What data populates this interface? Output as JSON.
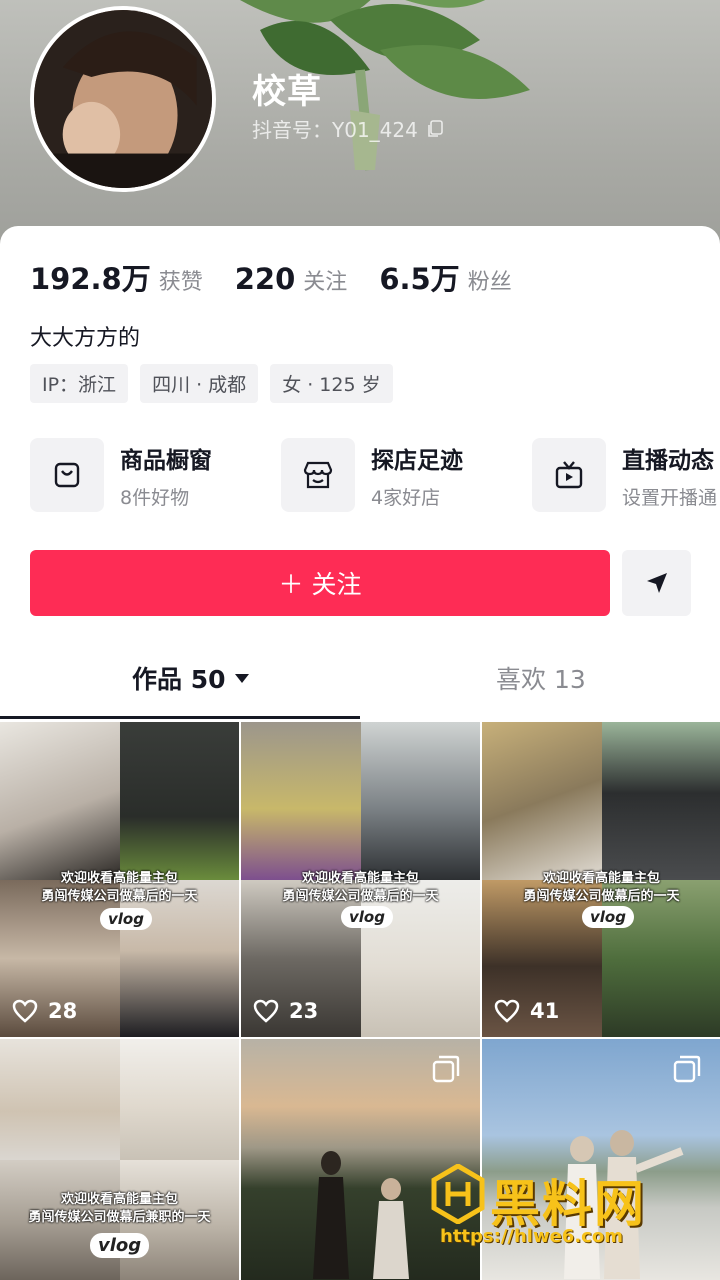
{
  "profile": {
    "name": "校草",
    "douyin_id": "抖音号：Y01_424"
  },
  "stats": [
    {
      "num": "192.8万",
      "label": "获赞"
    },
    {
      "num": "220",
      "label": "关注"
    },
    {
      "num": "6.5万",
      "label": "粉丝"
    }
  ],
  "bio": "大大方方的",
  "tags": [
    "IP：浙江",
    "四川 · 成都",
    "女 · 125 岁"
  ],
  "features": [
    {
      "title": "商品橱窗",
      "sub": "8件好物",
      "icon": "shopping-bag-icon"
    },
    {
      "title": "探店足迹",
      "sub": "4家好店",
      "icon": "store-icon"
    },
    {
      "title": "直播动态",
      "sub": "设置开播通",
      "icon": "tv-icon"
    }
  ],
  "actions": {
    "follow": "＋ 关注"
  },
  "tabs": {
    "works_label": "作品 50",
    "likes_label": "喜欢 13"
  },
  "videos": [
    {
      "likes": "28",
      "badge": "vlog",
      "caption1": "欢迎收看高能量主包",
      "caption2": "勇闯传媒公司做幕后的一天"
    },
    {
      "likes": "23",
      "badge": "vlog",
      "caption1": "欢迎收看高能量主包",
      "caption2": "勇闯传媒公司做幕后的一天"
    },
    {
      "likes": "41",
      "badge": "vlog",
      "caption1": "欢迎收看高能量主包",
      "caption2": "勇闯传媒公司做幕后的一天"
    },
    {
      "badge": "vlog",
      "caption1": "欢迎收看高能量主包",
      "caption2": "勇闯传媒公司做幕后兼职的一天"
    },
    {
      "type": "multi"
    },
    {
      "type": "multi"
    }
  ],
  "watermark": {
    "text": "黑料网",
    "url": "https://hlwe6.com"
  },
  "colors": {
    "accent": "#fe2c55",
    "text": "#161823",
    "muted": "#8a8b91",
    "chip": "#f2f2f4"
  }
}
